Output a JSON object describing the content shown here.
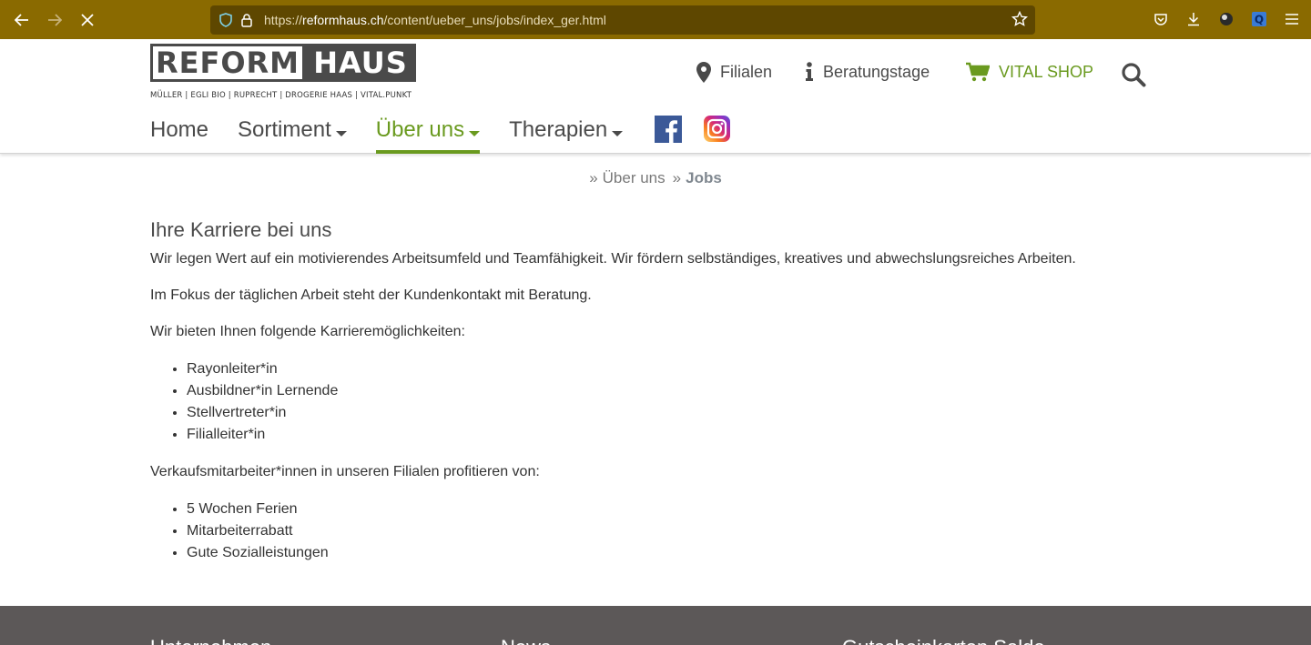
{
  "browser": {
    "url_prefix": "https://",
    "url_domain": "reformhaus.ch",
    "url_path": "/content/ueber_uns/jobs/index_ger.html"
  },
  "header": {
    "logo_left": "REFORM",
    "logo_right": "HAUS",
    "logo_sub": "MÜLLER | EGLI BIO | RUPRECHT | DROGERIE HAAS | VITAL.PUNKT",
    "filialen": "Filialen",
    "beratung": "Beratungstage",
    "shop": "VITAL SHOP"
  },
  "nav": {
    "home": "Home",
    "sortiment": "Sortiment",
    "ueber_uns": "Über uns",
    "therapien": "Therapien"
  },
  "breadcrumb": {
    "sep": "»",
    "parent": "Über uns",
    "current": "Jobs"
  },
  "content": {
    "title": "Ihre Karriere bei uns",
    "p1": "Wir legen Wert auf ein motivierendes Arbeitsumfeld und Teamfähigkeit. Wir fördern selbständiges, kreatives und abwechslungsreiches Arbeiten.",
    "p2": "Im Fokus der täglichen Arbeit steht der Kundenkontakt mit Beratung.",
    "p3": "Wir bieten Ihnen folgende Karrieremöglichkeiten:",
    "careers": [
      "Rayonleiter*in",
      "Ausbildner*in Lernende",
      "Stellvertreter*in",
      "Filialleiter*in"
    ],
    "p4": "Verkaufsmitarbeiter*innen in unseren Filialen profitieren von:",
    "benefits": [
      "5 Wochen Ferien",
      "Mitarbeiterrabatt",
      "Gute Sozialleistungen"
    ]
  },
  "footer": {
    "col1": "Unternehmen",
    "col2": "News",
    "col3": "Gutscheinkarten Saldo"
  },
  "colors": {
    "accent_green": "#6a9a1f",
    "chrome_bg": "#8a6a00",
    "footer_bg": "#5c5858"
  }
}
